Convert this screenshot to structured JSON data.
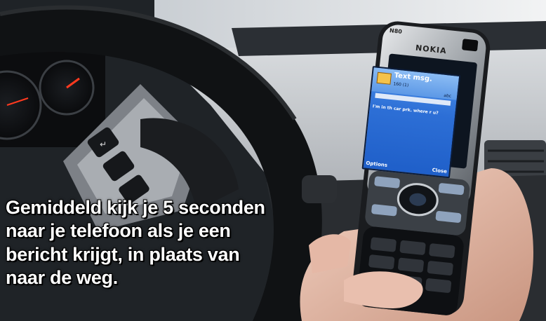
{
  "caption": {
    "line1": "Gemiddeld kijk je 5 seconden",
    "line2": "naar je telefoon als je een",
    "line3": "bericht krijgt, in plaats van",
    "line4": "naar de weg."
  },
  "phone": {
    "brand": "NOKIA",
    "model": "N80",
    "screen_title": "Text msg.",
    "char_counter": "160 (1)",
    "input_mode": "abc",
    "message": "I'm in th car prk. where r u?",
    "left_softkey": "Options",
    "right_softkey": "Close"
  },
  "colors": {
    "screen_blue": "#2d6fd6",
    "caption_text": "#ffffff",
    "caption_outline": "#000000"
  }
}
